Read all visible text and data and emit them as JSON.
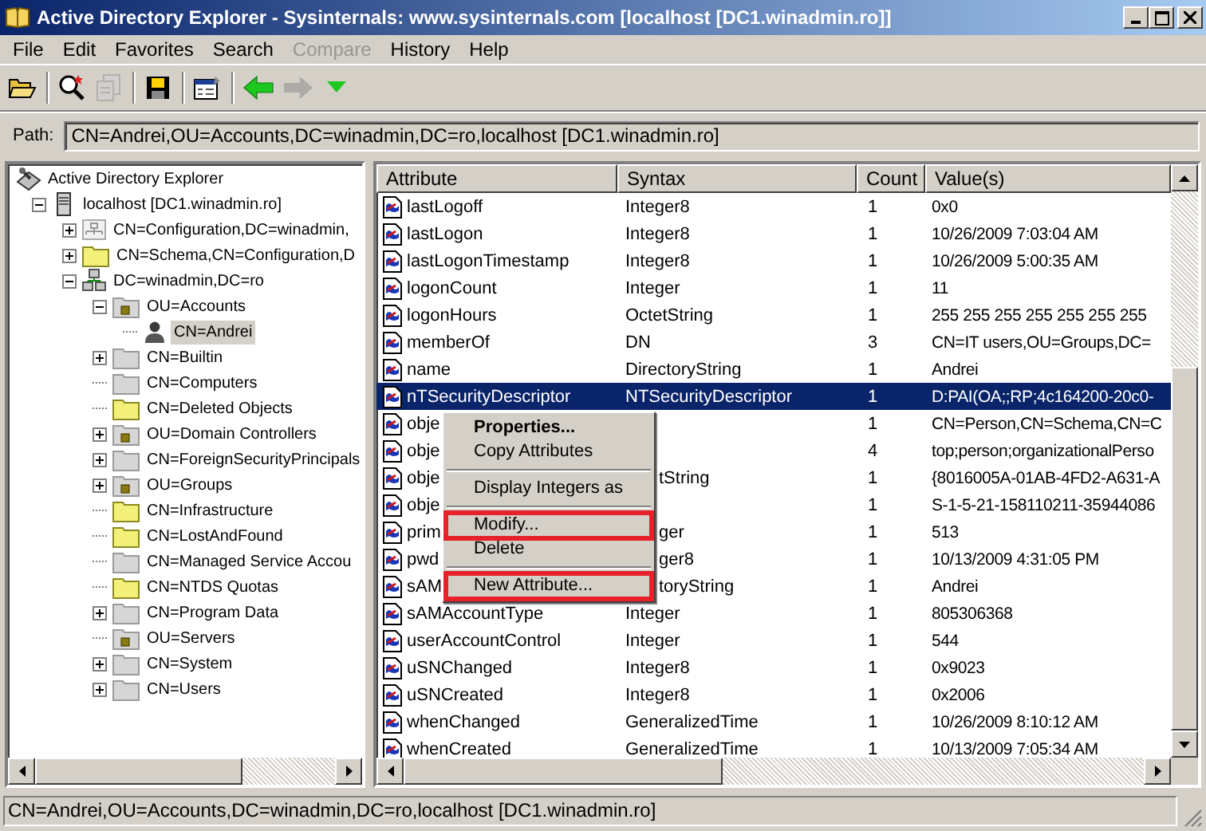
{
  "window": {
    "title": "Active Directory Explorer - Sysinternals: www.sysinternals.com [localhost [DC1.winadmin.ro]]"
  },
  "menu": [
    {
      "label": "File",
      "disabled": false
    },
    {
      "label": "Edit",
      "disabled": false
    },
    {
      "label": "Favorites",
      "disabled": false
    },
    {
      "label": "Search",
      "disabled": false
    },
    {
      "label": "Compare",
      "disabled": true
    },
    {
      "label": "History",
      "disabled": false
    },
    {
      "label": "Help",
      "disabled": false
    }
  ],
  "toolbar": [
    {
      "kind": "open",
      "disabled": false
    },
    {
      "kind": "separator"
    },
    {
      "kind": "search",
      "disabled": false
    },
    {
      "kind": "compare",
      "disabled": true
    },
    {
      "kind": "separator"
    },
    {
      "kind": "save",
      "disabled": false
    },
    {
      "kind": "separator"
    },
    {
      "kind": "properties",
      "disabled": false
    },
    {
      "kind": "separator"
    },
    {
      "kind": "back",
      "disabled": false
    },
    {
      "kind": "forward",
      "disabled": true
    },
    {
      "kind": "dropdown",
      "disabled": false
    }
  ],
  "path": {
    "label": "Path:",
    "value": "CN=Andrei,OU=Accounts,DC=winadmin,DC=ro,localhost [DC1.winadmin.ro]"
  },
  "tree": [
    {
      "label": "Active Directory Explorer",
      "kind": "root",
      "selected": false,
      "children": [
        {
          "label": "localhost [DC1.winadmin.ro]",
          "kind": "server",
          "expanded": true,
          "selected": false,
          "children": [
            {
              "label": "CN=Configuration,DC=winadmin,",
              "kind": "config",
              "expanded": false,
              "selected": false
            },
            {
              "label": "CN=Schema,CN=Configuration,D",
              "kind": "folder-yellow",
              "expanded": false,
              "selected": false
            },
            {
              "label": "DC=winadmin,DC=ro",
              "kind": "domain",
              "expanded": true,
              "selected": false,
              "children": [
                {
                  "label": "OU=Accounts",
                  "kind": "ou",
                  "expanded": true,
                  "selected": false,
                  "children": [
                    {
                      "label": "CN=Andrei",
                      "kind": "user",
                      "selected": true
                    }
                  ]
                },
                {
                  "label": "CN=Builtin",
                  "kind": "folder",
                  "expanded": false,
                  "selected": false
                },
                {
                  "label": "CN=Computers",
                  "kind": "folder",
                  "selected": false
                },
                {
                  "label": "CN=Deleted Objects",
                  "kind": "folder-yellow",
                  "selected": false
                },
                {
                  "label": "OU=Domain Controllers",
                  "kind": "ou",
                  "expanded": false,
                  "selected": false
                },
                {
                  "label": "CN=ForeignSecurityPrincipals",
                  "kind": "folder",
                  "expanded": false,
                  "selected": false
                },
                {
                  "label": "OU=Groups",
                  "kind": "ou",
                  "expanded": false,
                  "selected": false
                },
                {
                  "label": "CN=Infrastructure",
                  "kind": "folder-yellow",
                  "selected": false
                },
                {
                  "label": "CN=LostAndFound",
                  "kind": "folder-yellow",
                  "selected": false
                },
                {
                  "label": "CN=Managed Service Accou",
                  "kind": "folder",
                  "selected": false
                },
                {
                  "label": "CN=NTDS Quotas",
                  "kind": "folder-yellow",
                  "selected": false
                },
                {
                  "label": "CN=Program Data",
                  "kind": "folder",
                  "expanded": false,
                  "selected": false
                },
                {
                  "label": "OU=Servers",
                  "kind": "ou",
                  "selected": false
                },
                {
                  "label": "CN=System",
                  "kind": "folder",
                  "expanded": false,
                  "selected": false
                },
                {
                  "label": "CN=Users",
                  "kind": "folder",
                  "expanded": false,
                  "selected": false
                }
              ]
            }
          ]
        }
      ]
    }
  ],
  "list": {
    "columns": [
      "Attribute",
      "Syntax",
      "Count",
      "Value(s)"
    ],
    "rows": [
      {
        "attribute": "lastLogoff",
        "syntax": "Integer8",
        "count": "1",
        "value": "0x0",
        "selected": false
      },
      {
        "attribute": "lastLogon",
        "syntax": "Integer8",
        "count": "1",
        "value": "10/26/2009 7:03:04 AM",
        "selected": false
      },
      {
        "attribute": "lastLogonTimestamp",
        "syntax": "Integer8",
        "count": "1",
        "value": "10/26/2009 5:00:35 AM",
        "selected": false
      },
      {
        "attribute": "logonCount",
        "syntax": "Integer",
        "count": "1",
        "value": "11",
        "selected": false
      },
      {
        "attribute": "logonHours",
        "syntax": "OctetString",
        "count": "1",
        "value": "255 255 255 255 255 255 255",
        "selected": false
      },
      {
        "attribute": "memberOf",
        "syntax": "DN",
        "count": "3",
        "value": "CN=IT users,OU=Groups,DC=",
        "selected": false
      },
      {
        "attribute": "name",
        "syntax": "DirectoryString",
        "count": "1",
        "value": "Andrei",
        "selected": false
      },
      {
        "attribute": "nTSecurityDescriptor",
        "syntax": "NTSecurityDescriptor",
        "count": "1",
        "value": "D:PAI(OA;;RP;4c164200-20c0-",
        "selected": true
      },
      {
        "attribute": "obje",
        "count": "1",
        "value": "CN=Person,CN=Schema,CN=C",
        "selected": false
      },
      {
        "attribute": "obje",
        "count": "4",
        "value": "top;person;organizationalPerso",
        "selected": false
      },
      {
        "attribute": "obje",
        "syntax": "tString",
        "count": "1",
        "value": "{8016005A-01AB-4FD2-A631-A",
        "selected": false,
        "covered": true
      },
      {
        "attribute": "obje",
        "count": "1",
        "value": "S-1-5-21-158110211-35944086",
        "selected": false
      },
      {
        "attribute": "prim",
        "syntax": "ger",
        "count": "1",
        "value": "513",
        "selected": false,
        "covered": true
      },
      {
        "attribute": "pwd",
        "syntax": "ger8",
        "count": "1",
        "value": "10/13/2009 4:31:05 PM",
        "selected": false,
        "covered": true
      },
      {
        "attribute": "sAM",
        "syntax": "toryString",
        "count": "1",
        "value": "Andrei",
        "selected": false,
        "covered": true
      },
      {
        "attribute": "sAMAccountType",
        "syntax": "Integer",
        "count": "1",
        "value": "805306368",
        "selected": false
      },
      {
        "attribute": "userAccountControl",
        "syntax": "Integer",
        "count": "1",
        "value": "544",
        "selected": false
      },
      {
        "attribute": "uSNChanged",
        "syntax": "Integer8",
        "count": "1",
        "value": "0x9023",
        "selected": false
      },
      {
        "attribute": "uSNCreated",
        "syntax": "Integer8",
        "count": "1",
        "value": "0x2006",
        "selected": false
      },
      {
        "attribute": "whenChanged",
        "syntax": "GeneralizedTime",
        "count": "1",
        "value": "10/26/2009 8:10:12 AM",
        "selected": false
      },
      {
        "attribute": "whenCreated",
        "syntax": "GeneralizedTime",
        "count": "1",
        "value": "10/13/2009 7:05:34 AM",
        "selected": false
      }
    ]
  },
  "context_menu": {
    "items": [
      {
        "kind": "item",
        "label": "Properties...",
        "default": true,
        "highlighted": false
      },
      {
        "kind": "item",
        "label": "Copy Attributes",
        "default": false,
        "highlighted": false
      },
      {
        "kind": "separator"
      },
      {
        "kind": "item",
        "label": "Display Integers as",
        "default": false,
        "highlighted": false
      },
      {
        "kind": "separator"
      },
      {
        "kind": "item",
        "label": "Modify...",
        "default": false,
        "highlighted": true
      },
      {
        "kind": "item",
        "label": "Delete",
        "default": false,
        "highlighted": false
      },
      {
        "kind": "separator"
      },
      {
        "kind": "item",
        "label": "New Attribute...",
        "default": false,
        "highlighted": true
      }
    ]
  },
  "status_bar": {
    "text": "CN=Andrei,OU=Accounts,DC=winadmin,DC=ro,localhost [DC1.winadmin.ro]"
  }
}
